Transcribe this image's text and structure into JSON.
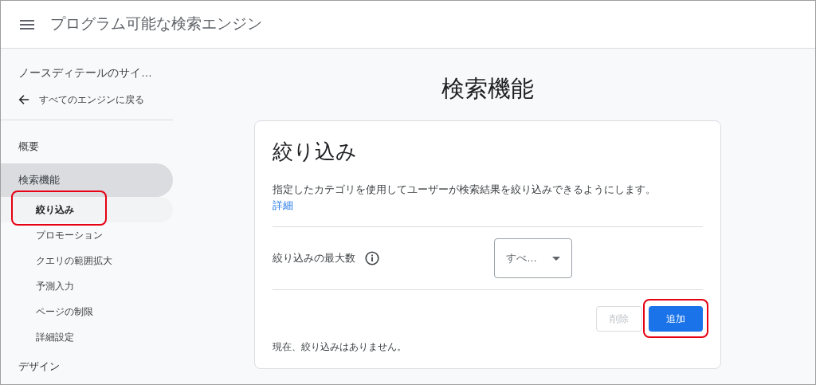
{
  "header": {
    "title": "プログラム可能な検索エンジン"
  },
  "sidebar": {
    "engine_name": "ノースディテールのサイ…",
    "back_link": "すべてのエンジンに戻る",
    "items": [
      {
        "label": "概要",
        "selected": false
      },
      {
        "label": "検索機能",
        "selected": true,
        "children": [
          {
            "label": "絞り込み",
            "selected": true,
            "highlighted": true
          },
          {
            "label": "プロモーション",
            "selected": false,
            "highlighted": false
          },
          {
            "label": "クエリの範囲拡大",
            "selected": false,
            "highlighted": false
          },
          {
            "label": "予測入力",
            "selected": false,
            "highlighted": false
          },
          {
            "label": "ページの制限",
            "selected": false,
            "highlighted": false
          },
          {
            "label": "詳細設定",
            "selected": false,
            "highlighted": false
          }
        ]
      },
      {
        "label": "デザイン",
        "selected": false
      }
    ]
  },
  "main": {
    "page_title": "検索機能",
    "card": {
      "title": "絞り込み",
      "description": "指定したカテゴリを使用してユーザーが検索結果を絞り込みできるようにします。",
      "link": "詳細",
      "setting": {
        "label": "絞り込みの最大数",
        "value": "すべ…"
      },
      "buttons": [
        {
          "label": "削除",
          "disabled": true,
          "highlighted": false
        },
        {
          "label": "追加",
          "disabled": false,
          "highlighted": true
        }
      ],
      "empty_message": "現在、絞り込みはありません。"
    }
  }
}
